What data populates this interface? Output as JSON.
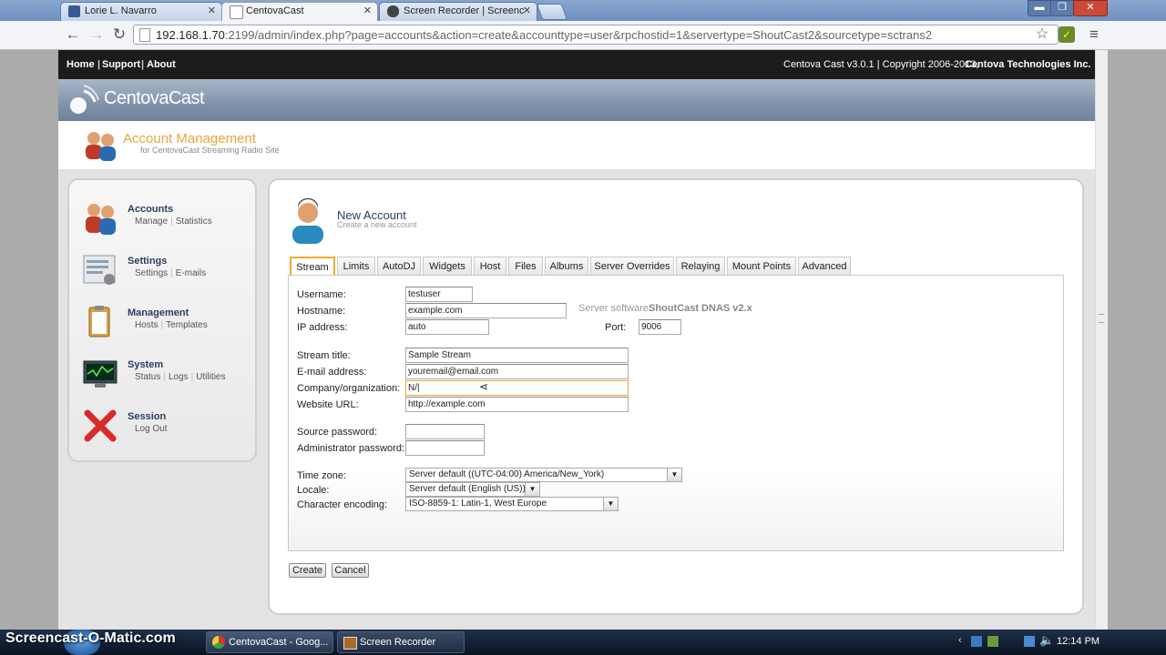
{
  "browser": {
    "tabs": [
      {
        "title": "Lorie L. Navarro",
        "icon": "facebook-icon"
      },
      {
        "title": "CentovaCast",
        "icon": "centova-icon"
      },
      {
        "title": "Screen Recorder | Screenc",
        "icon": "screen-recorder-icon"
      }
    ],
    "url_host": "192.168.1.70",
    "url_rest": ":2199/admin/index.php?page=accounts&action=create&accounttype=user&rpchostid=1&servertype=ShoutCast2&sourcetype=sctrans2",
    "window_buttons": {
      "minimize": "▬",
      "maximize": "❐",
      "close": "✕"
    }
  },
  "topnav": {
    "links": [
      "Home",
      "Support",
      "About"
    ],
    "copyright": "Centova Cast v3.0.1 | Copyright 2006-2013,",
    "company": "Centova Technologies Inc."
  },
  "logo": {
    "text": "CentovaCast"
  },
  "header": {
    "title": "Account Management",
    "subtitle": "for CentovaCast Streaming Radio Site"
  },
  "sidebar": {
    "items": [
      {
        "title": "Accounts",
        "links": [
          "Manage",
          "Statistics"
        ],
        "icon": "users-icon"
      },
      {
        "title": "Settings",
        "links": [
          "Settings",
          "E-mails"
        ],
        "icon": "settings-icon"
      },
      {
        "title": "Management",
        "links": [
          "Hosts",
          "Templates"
        ],
        "icon": "clipboard-icon"
      },
      {
        "title": "System",
        "links": [
          "Status",
          "Logs",
          "Utilities"
        ],
        "icon": "monitor-icon"
      },
      {
        "title": "Session",
        "links": [
          "Log Out"
        ],
        "icon": "close-x-icon"
      }
    ]
  },
  "page": {
    "title": "New Account",
    "subtitle": "Create a new account"
  },
  "tabs": [
    "Stream",
    "Limits",
    "AutoDJ",
    "Widgets",
    "Host",
    "Files",
    "Albums",
    "Server Overrides",
    "Relaying",
    "Mount Points",
    "Advanced"
  ],
  "active_tab": "Stream",
  "form": {
    "username": {
      "label": "Username:",
      "value": "testuser"
    },
    "hostname": {
      "label": "Hostname:",
      "value": "example.com"
    },
    "ip": {
      "label": "IP address:",
      "value": "auto"
    },
    "server_software": {
      "label": "Server software:",
      "value": "ShoutCast DNAS v2.x"
    },
    "port": {
      "label": "Port:",
      "value": "9006"
    },
    "stream_title": {
      "label": "Stream title:",
      "value": "Sample Stream"
    },
    "email": {
      "label": "E-mail address:",
      "value": "youremail@email.com"
    },
    "company": {
      "label": "Company/organization:",
      "value": "N/|"
    },
    "website": {
      "label": "Website URL:",
      "value": "http://example.com"
    },
    "source_password": {
      "label": "Source password:",
      "value": ""
    },
    "admin_password": {
      "label": "Administrator password:",
      "value": ""
    },
    "timezone": {
      "label": "Time zone:",
      "value": "Server default ((UTC-04:00) America/New_York)"
    },
    "locale": {
      "label": "Locale:",
      "value": "Server default (English (US))"
    },
    "encoding": {
      "label": "Character encoding:",
      "value": "ISO-8859-1: Latin-1, West Europe"
    }
  },
  "buttons": {
    "create": "Create",
    "cancel": "Cancel"
  },
  "taskbar": {
    "watermark": "Screencast-O-Matic.com",
    "tasks": [
      "CentovaCast - Goog...",
      "Screen Recorder"
    ],
    "clock": "12:14 PM"
  },
  "colors": {
    "accent_orange": "#e8a53a",
    "nav_dark": "#1c1c1c",
    "title_blue": "#2a3e63"
  }
}
